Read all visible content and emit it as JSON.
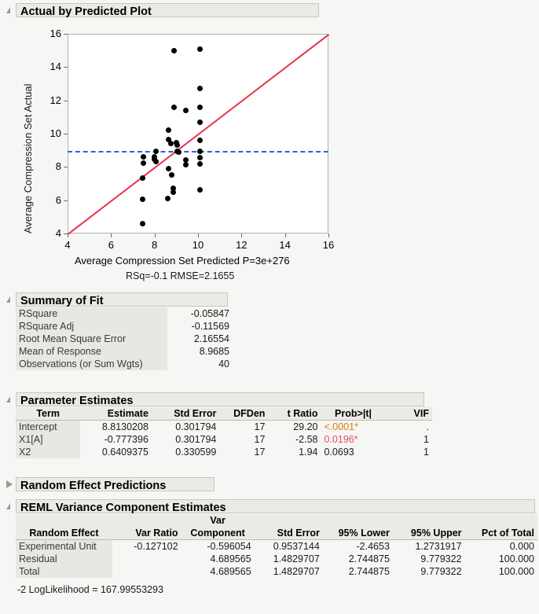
{
  "sections": {
    "actual_by_predicted": "Actual by Predicted Plot",
    "summary_of_fit": "Summary of Fit",
    "parameter_estimates": "Parameter Estimates",
    "random_effect_predictions": "Random Effect Predictions",
    "reml": "REML Variance Component Estimates"
  },
  "chart_data": {
    "type": "scatter",
    "title": "Actual by Predicted Plot",
    "xlabel": "Average Compression Set Predicted P=3e+276",
    "ylabel": "Average Compression Set Actual",
    "annotation": "RSq=-0.1 RMSE=2.1655",
    "xlim": [
      4,
      16
    ],
    "ylim": [
      4,
      16
    ],
    "xticks": [
      4,
      6,
      8,
      10,
      12,
      14,
      16
    ],
    "yticks": [
      4,
      6,
      8,
      10,
      12,
      14,
      16
    ],
    "grid": false,
    "legend": "none",
    "reference_lines": [
      {
        "name": "identity-line",
        "type": "diagonal",
        "color": "#e8334a",
        "from": [
          4,
          4
        ],
        "to": [
          16,
          16
        ],
        "style": "solid"
      },
      {
        "name": "mean-response-line",
        "type": "horizontal",
        "color": "#2b63d9",
        "y": 8.9685,
        "style": "dashed"
      }
    ],
    "point_color": "#000000",
    "points": [
      [
        8.9,
        15.0
      ],
      [
        10.1,
        15.1
      ],
      [
        10.1,
        12.7
      ],
      [
        10.1,
        11.6
      ],
      [
        8.9,
        11.6
      ],
      [
        9.45,
        11.4
      ],
      [
        10.1,
        10.7
      ],
      [
        8.65,
        10.2
      ],
      [
        8.65,
        9.65
      ],
      [
        8.75,
        9.4
      ],
      [
        9.0,
        9.45
      ],
      [
        9.05,
        9.3
      ],
      [
        10.1,
        9.6
      ],
      [
        10.1,
        8.95
      ],
      [
        10.1,
        8.55
      ],
      [
        10.1,
        8.2
      ],
      [
        8.05,
        8.95
      ],
      [
        8.0,
        8.6
      ],
      [
        8.0,
        8.45
      ],
      [
        8.05,
        8.3
      ],
      [
        7.5,
        8.6
      ],
      [
        7.5,
        8.25
      ],
      [
        9.05,
        8.95
      ],
      [
        9.1,
        8.9
      ],
      [
        9.45,
        8.4
      ],
      [
        9.45,
        8.15
      ],
      [
        8.65,
        7.9
      ],
      [
        8.8,
        7.5
      ],
      [
        7.45,
        7.35
      ],
      [
        8.85,
        6.7
      ],
      [
        8.85,
        6.5
      ],
      [
        10.1,
        6.6
      ],
      [
        8.6,
        6.1
      ],
      [
        7.45,
        6.05
      ],
      [
        7.45,
        4.6
      ]
    ]
  },
  "summary_of_fit": {
    "rows": [
      {
        "label": "RSquare",
        "value": "-0.05847"
      },
      {
        "label": "RSquare Adj",
        "value": "-0.11569"
      },
      {
        "label": "Root Mean Square Error",
        "value": "2.16554"
      },
      {
        "label": "Mean of Response",
        "value": "8.9685"
      },
      {
        "label": "Observations (or Sum Wgts)",
        "value": "40"
      }
    ]
  },
  "parameter_estimates": {
    "headers": [
      "Term",
      "Estimate",
      "Std Error",
      "DFDen",
      "t Ratio",
      "Prob>|t|",
      "VIF"
    ],
    "rows": [
      {
        "term": "Intercept",
        "estimate": "8.8130208",
        "std_error": "0.301794",
        "dfden": "17",
        "t_ratio": "29.20",
        "prob": "<.0001*",
        "prob_color": "orange",
        "vif": "."
      },
      {
        "term": "X1[A]",
        "estimate": "-0.777396",
        "std_error": "0.301794",
        "dfden": "17",
        "t_ratio": "-2.58",
        "prob": "0.0196*",
        "prob_color": "red",
        "vif": "1"
      },
      {
        "term": "X2",
        "estimate": "0.6409375",
        "std_error": "0.330599",
        "dfden": "17",
        "t_ratio": "1.94",
        "prob": "0.0693",
        "prob_color": "none",
        "vif": "1"
      }
    ]
  },
  "reml": {
    "header_top": "Var",
    "headers": [
      "Random Effect",
      "Var Ratio",
      "Component",
      "Std Error",
      "95% Lower",
      "95% Upper",
      "Pct of Total"
    ],
    "rows": [
      {
        "effect": "Experimental Unit",
        "var_ratio": "-0.127102",
        "var_component": "-0.596054",
        "std_error": "0.9537144",
        "lower": "-2.4653",
        "upper": "1.2731917",
        "pct": "0.000"
      },
      {
        "effect": "Residual",
        "var_ratio": "",
        "var_component": "4.689565",
        "std_error": "1.4829707",
        "lower": "2.744875",
        "upper": "9.779322",
        "pct": "100.000"
      },
      {
        "effect": "Total",
        "var_ratio": "",
        "var_component": "4.689565",
        "std_error": "1.4829707",
        "lower": "2.744875",
        "upper": "9.779322",
        "pct": "100.000"
      }
    ],
    "loglikelihood_label": "-2 LogLikelihood = ",
    "loglikelihood_value": "167.99553293"
  }
}
